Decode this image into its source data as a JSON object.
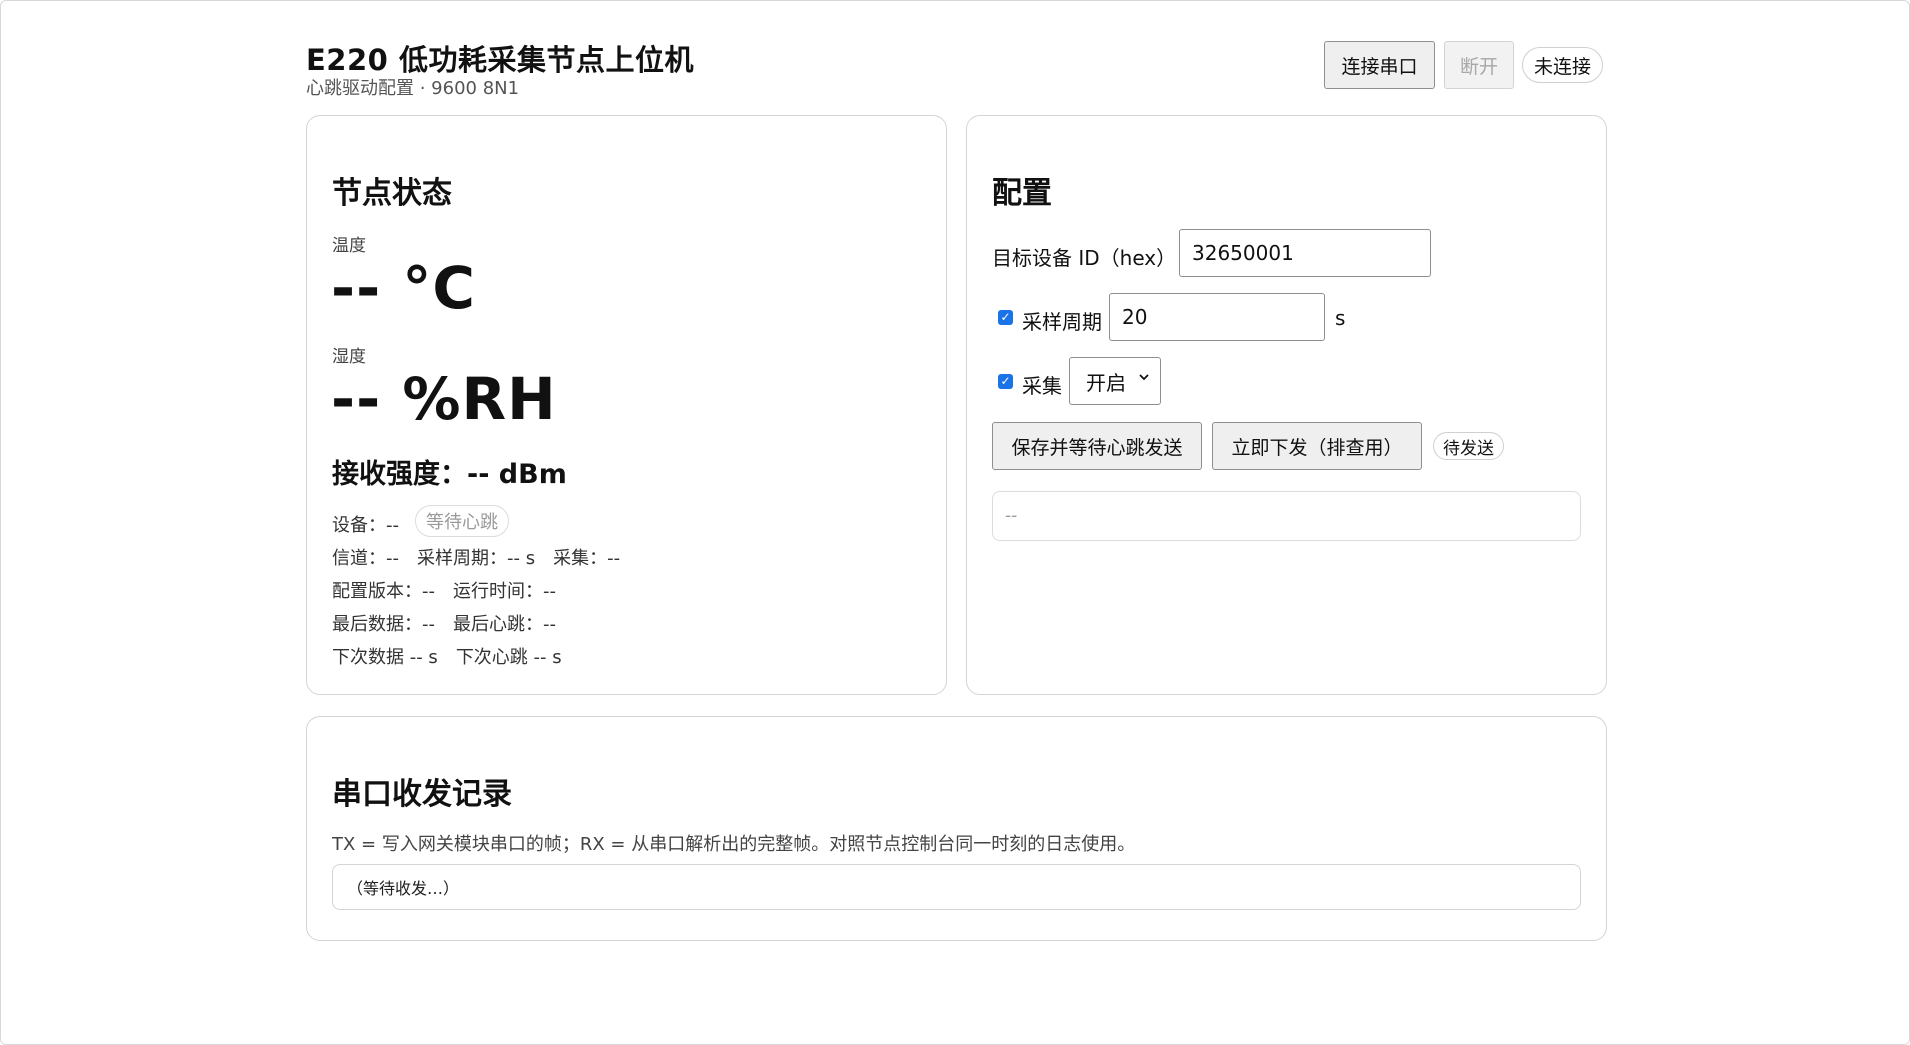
{
  "header": {
    "title": "E220 低功耗采集节点上位机",
    "subtitle": "心跳驱动配置 · 9600 8N1",
    "connect_label": "连接串口",
    "disconnect_label": "断开",
    "status_label": "未连接"
  },
  "status": {
    "title": "节点状态",
    "temp_label": "温度",
    "temp_value": "-- °C",
    "hum_label": "湿度",
    "hum_value": "-- %RH",
    "rssi_text": "接收强度：-- dBm",
    "device_text": "设备：--",
    "wait_label": "等待心跳",
    "channel_text": "信道：--",
    "period_text": "采样周期：-- s",
    "collect_text": "采集：--",
    "cfgver_text": "配置版本：--",
    "uptime_text": "运行时间：--",
    "lastdata_text": "最后数据：--",
    "lasthb_text": "最后心跳：--",
    "nextdata_text": "下次数据 -- s",
    "nexthb_text": "下次心跳 -- s"
  },
  "config": {
    "title": "配置",
    "target_label": "目标设备 ID（hex）",
    "target_value": "32650001",
    "period_label": "采样周期",
    "period_value": "20",
    "period_unit": "s",
    "collect_label": "采集",
    "collect_value": "开启",
    "save_label": "保存并等待心跳发送",
    "send_now_label": "立即下发（排查用）",
    "pending_label": "待发送",
    "result_text": "--"
  },
  "log": {
    "title": "串口收发记录",
    "description": "TX = 写入网关模块串口的帧；RX = 从串口解析出的完整帧。对照节点控制台同一时刻的日志使用。",
    "placeholder": "（等待收发…）"
  },
  "colors": {
    "accent": "#1a73e8",
    "border": "#d4d4d4",
    "muted": "#9a9a9a"
  },
  "icons": {
    "checkbox": "check-icon",
    "select": "chevron-down-icon"
  }
}
